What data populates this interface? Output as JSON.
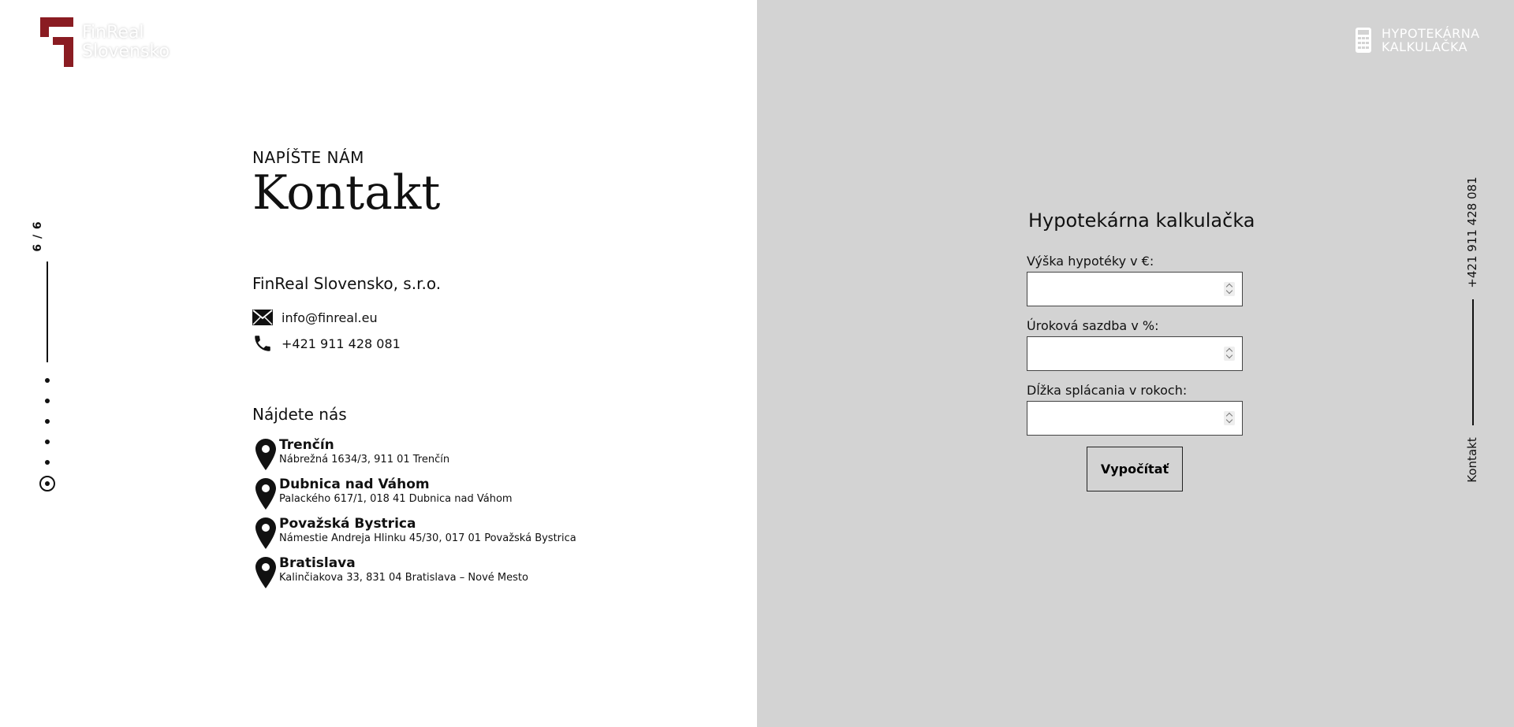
{
  "logo": {
    "line1": "FinReal",
    "line2": "Slovensko",
    "mark_color": "#8a1c22"
  },
  "pager": {
    "count": "6 / 6",
    "total": 6,
    "current": 6
  },
  "contact": {
    "eyebrow": "NAPÍŠTE NÁM",
    "title": "Kontakt",
    "company": "FinReal Slovensko, s.r.o.",
    "email": "info@finreal.eu",
    "phone": "+421 911 428 081",
    "icons": [
      "envelope-icon",
      "phone-icon"
    ]
  },
  "locations": {
    "title": "Nájdete nás",
    "items": [
      {
        "name": "Trenčín",
        "address": "Nábrežná 1634/3, 911 01 Trenčín"
      },
      {
        "name": "Dubnica nad Váhom",
        "address": "Palackého 617/1, 018 41 Dubnica nad Váhom"
      },
      {
        "name": "Považská Bystrica",
        "address": "Námestie Andreja Hlinku 45/30, 017 01 Považská Bystrica"
      },
      {
        "name": "Bratislava",
        "address": "Kalinčiakova 33, 831 04 Bratislava – Nové Mesto"
      }
    ]
  },
  "header": {
    "calc_link_line1": "HYPOTEKÁRNA",
    "calc_link_line2": "KALKULAČKA"
  },
  "sidebar": {
    "phone": "+421 911 428 081",
    "label": "Kontakt"
  },
  "calculator": {
    "title": "Hypotekárna kalkulačka",
    "fields": [
      {
        "label": "Výška hypotéky v €:",
        "value": ""
      },
      {
        "label": "Úroková sazdba v %:",
        "value": ""
      },
      {
        "label": "Dĺžka splácania v rokoch:",
        "value": ""
      }
    ],
    "button": "Vypočítať"
  },
  "colors": {
    "left_bg": "#ffffff",
    "right_bg": "#d3d3d3",
    "brand": "#8a1c22"
  }
}
